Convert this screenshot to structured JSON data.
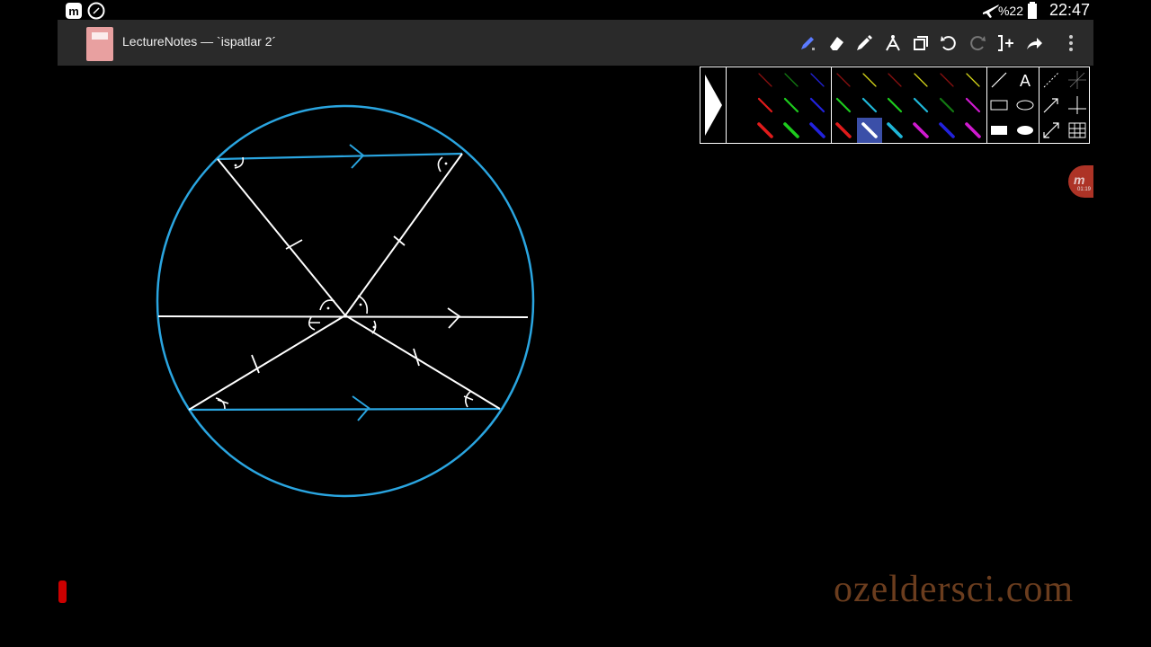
{
  "status_bar": {
    "icons": [
      "notification-app-icon",
      "compass-icon",
      "airplane-mode-icon",
      "battery-icon"
    ],
    "battery": "%22",
    "time": "22:47"
  },
  "action_bar": {
    "title": "LectureNotes — `ispatlar 2´",
    "tools": [
      "pen-tool-icon",
      "eraser-icon",
      "highlighter-icon",
      "compass-tool-icon",
      "copy-icon",
      "undo-icon",
      "redo-icon",
      "insert-icon",
      "share-icon",
      "overflow-menu-icon"
    ]
  },
  "palette": {
    "colors": {
      "black": "#000000",
      "red": "#e01b1b",
      "green": "#1ecb1e",
      "blue": "#2222dd",
      "yellow": "#d8d81a",
      "cyan": "#1fb7d8",
      "darkred": "#8b1010",
      "darkgreen": "#137a13",
      "magenta": "#d01ad0",
      "white": "#ffffff"
    },
    "text_tool": "A",
    "selected": "white-thick"
  },
  "drawing": {
    "circle_color": "#2aa5e0",
    "line_color": "#ffffff"
  },
  "side_handle": {
    "label": "m",
    "timer": "01:19"
  },
  "watermark": "ozeldersci.com"
}
